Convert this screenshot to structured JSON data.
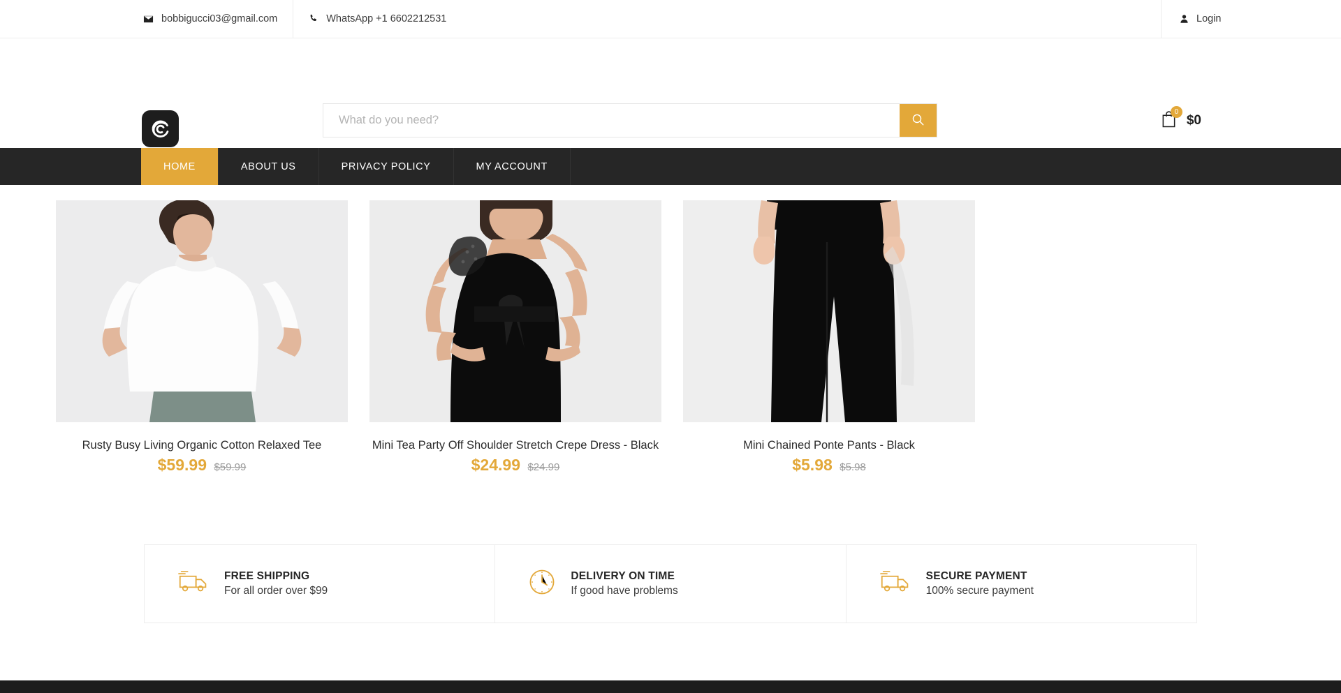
{
  "topbar": {
    "email": "bobbigucci03@gmail.com",
    "phone": "WhatsApp +1 6602212531",
    "login": "Login",
    "email_icon": "envelope-icon",
    "phone_icon": "phone-icon",
    "user_icon": "user-icon"
  },
  "header": {
    "logo_alt": "brand-logo",
    "search": {
      "placeholder": "What do you need?",
      "value": "",
      "button_icon": "search-icon"
    },
    "cart": {
      "count": "0",
      "total": "$0",
      "icon": "shopping-bag-icon"
    }
  },
  "nav": {
    "items": [
      {
        "label": "HOME",
        "active": true
      },
      {
        "label": "ABOUT US",
        "active": false
      },
      {
        "label": "PRIVACY POLICY",
        "active": false
      },
      {
        "label": "MY ACCOUNT",
        "active": false
      }
    ]
  },
  "products": [
    {
      "name": "Rusty Busy Living Organic Cotton Relaxed Tee",
      "price": "$59.99",
      "old_price": "$59.99",
      "image_alt": "woman-wearing-white-relaxed-tee"
    },
    {
      "name": "Mini Tea Party Off Shoulder Stretch Crepe Dress - Black",
      "price": "$24.99",
      "old_price": "$24.99",
      "image_alt": "woman-wearing-black-off-shoulder-dress"
    },
    {
      "name": "Mini Chained Ponte Pants - Black",
      "price": "$5.98",
      "old_price": "$5.98",
      "image_alt": "woman-wearing-black-wide-leg-pants"
    }
  ],
  "features": [
    {
      "title": "FREE SHIPPING",
      "subtitle": "For all order over $99",
      "icon": "delivery-truck-icon"
    },
    {
      "title": "DELIVERY ON TIME",
      "subtitle": "If good have problems",
      "icon": "clock-icon"
    },
    {
      "title": "SECURE PAYMENT",
      "subtitle": "100% secure payment",
      "icon": "delivery-truck-icon"
    }
  ],
  "colors": {
    "accent": "#e3a839",
    "dark": "#262626",
    "text": "#2b2b2b"
  }
}
